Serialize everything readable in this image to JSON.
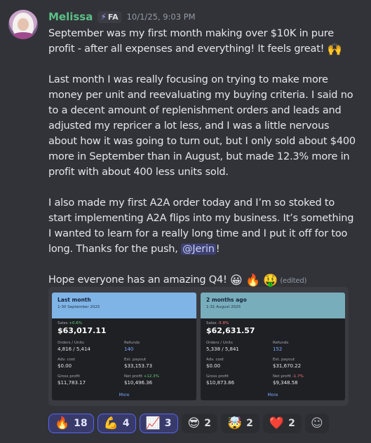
{
  "author": {
    "name": "Melissa",
    "tag_icon": "lightning-bolt-icon",
    "tag": "FA",
    "timestamp": "10/1/25, 9:03 PM"
  },
  "message": {
    "p1": "September was my first month making over $10K in pure profit - after all expenses and everything! It feels great! ",
    "p1_emoji": "🙌",
    "p2": "Last month I was really focusing on trying to make more money per unit and reevaluating my buying criteria. I said no to a decent amount of replenishment orders and leads and adjusted my repricer a lot less, and I was a little nervous about how it was going to turn out, but I only sold about $400 more in September than in August, but made 12.3% more in profit with about 400 less units sold.",
    "p3": "I also made my first A2A order today and I’m so stoked to start implementing A2A flips into my business. It’s something I wanted to learn for a really long time and I put it off for too long. Thanks for the push, ",
    "p3_mention": "@Jerin",
    "p3_end": "!",
    "p4": "Hope everyone has an amazing Q4! ",
    "p4_emojis": [
      "😀",
      "🔥",
      "🤑"
    ],
    "edited": "(edited)"
  },
  "cards": [
    {
      "title": "Last month",
      "subtitle": "1-30 September 2025",
      "sales_label": "Sales",
      "sales_change": "+0.6%",
      "sales_dir": "up",
      "sales_value": "$63,017.11",
      "orders_label": "Orders / Units",
      "orders_value": "4,816 / 5,414",
      "refunds_label": "Refunds",
      "refunds_value": "140",
      "adv_label": "Adv. cost",
      "adv_value": "$0.00",
      "payout_label": "Est. payout",
      "payout_value": "$33,153.73",
      "gross_label": "Gross profit",
      "gross_value": "$11,783.17",
      "net_label": "Net profit",
      "net_change": "+12.3%",
      "net_dir": "up",
      "net_value": "$10,496.36",
      "more": "More"
    },
    {
      "title": "2 months ago",
      "subtitle": "1-31 August 2025",
      "sales_label": "Sales",
      "sales_change": "-5.8%",
      "sales_dir": "down",
      "sales_value": "$62,631.57",
      "orders_label": "Orders / Units",
      "orders_value": "5,338 / 5,841",
      "refunds_label": "Refunds",
      "refunds_value": "152",
      "adv_label": "Adv. cost",
      "adv_value": "$0.00",
      "payout_label": "Est. payout",
      "payout_value": "$31,670.22",
      "gross_label": "Gross profit",
      "gross_value": "$10,873.86",
      "net_label": "Net profit",
      "net_change": "-1.7%",
      "net_dir": "down",
      "net_value": "$9,348.58",
      "more": "More"
    }
  ],
  "reactions": [
    {
      "emoji": "🔥",
      "count": "18",
      "active": true
    },
    {
      "emoji": "💪",
      "count": "4",
      "active": true
    },
    {
      "emoji": "📈",
      "count": "3",
      "active": true
    },
    {
      "emoji": "😎",
      "count": "2",
      "active": false
    },
    {
      "emoji": "🤯",
      "count": "2",
      "active": false
    },
    {
      "emoji": "❤️",
      "count": "2",
      "active": false
    }
  ],
  "add_reaction_icon": "☺"
}
